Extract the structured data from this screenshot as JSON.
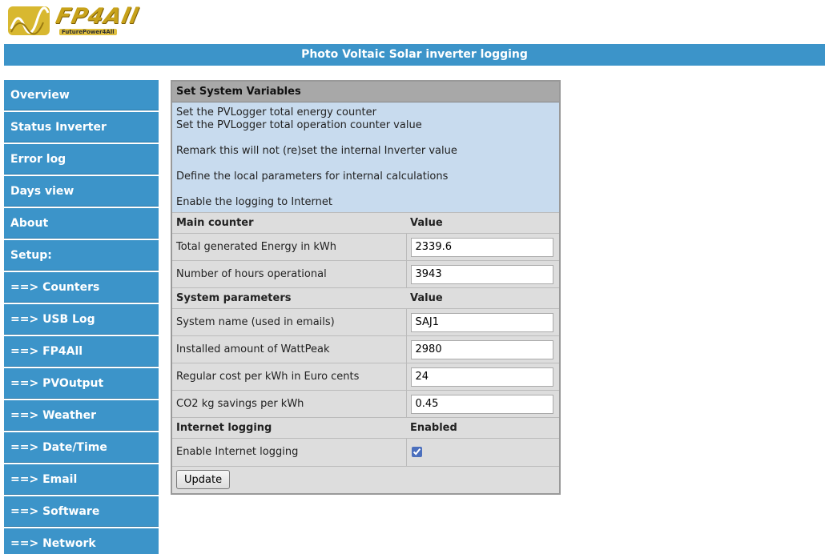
{
  "logo": {
    "text": "FP4All",
    "subtext": "FuturePower4All"
  },
  "header": {
    "title": "Photo Voltaic Solar inverter logging"
  },
  "sidebar": {
    "items": [
      {
        "label": "Overview"
      },
      {
        "label": "Status Inverter"
      },
      {
        "label": "Error log"
      },
      {
        "label": "Days view"
      },
      {
        "label": "About"
      },
      {
        "label": "Setup:"
      },
      {
        "label": "==> Counters"
      },
      {
        "label": "==> USB Log"
      },
      {
        "label": "==> FP4All"
      },
      {
        "label": "==> PVOutput"
      },
      {
        "label": "==> Weather"
      },
      {
        "label": "==> Date/Time"
      },
      {
        "label": "==> Email"
      },
      {
        "label": "==> Software"
      },
      {
        "label": "==> Network"
      }
    ]
  },
  "panel": {
    "title": "Set System Variables",
    "info": [
      "Set the PVLogger total energy counter",
      "Set the PVLogger total operation counter value",
      "Remark this will not (re)set the internal Inverter value",
      "Define the local parameters for internal calculations",
      "Enable the logging to Internet"
    ],
    "sections": {
      "main": {
        "header": "Main counter",
        "value_header": "Value",
        "rows": [
          {
            "label": "Total generated Energy in kWh",
            "value": "2339.6"
          },
          {
            "label": "Number of hours operational",
            "value": "3943"
          }
        ]
      },
      "system": {
        "header": "System parameters",
        "value_header": "Value",
        "rows": [
          {
            "label": "System name (used in emails)",
            "value": "SAJ1"
          },
          {
            "label": "Installed amount of WattPeak",
            "value": "2980"
          },
          {
            "label": "Regular cost per kWh in Euro cents",
            "value": "24"
          },
          {
            "label": "CO2 kg savings per kWh",
            "value": "0.45"
          }
        ]
      },
      "internet": {
        "header": "Internet logging",
        "value_header": "Enabled",
        "row_label": "Enable Internet logging",
        "checked": true
      }
    },
    "update_label": "Update"
  },
  "colors": {
    "accent": "#3c94c9",
    "panel_bg": "#dddddd",
    "info_bg": "#c8dbee",
    "title_bg": "#a8a8a8"
  }
}
